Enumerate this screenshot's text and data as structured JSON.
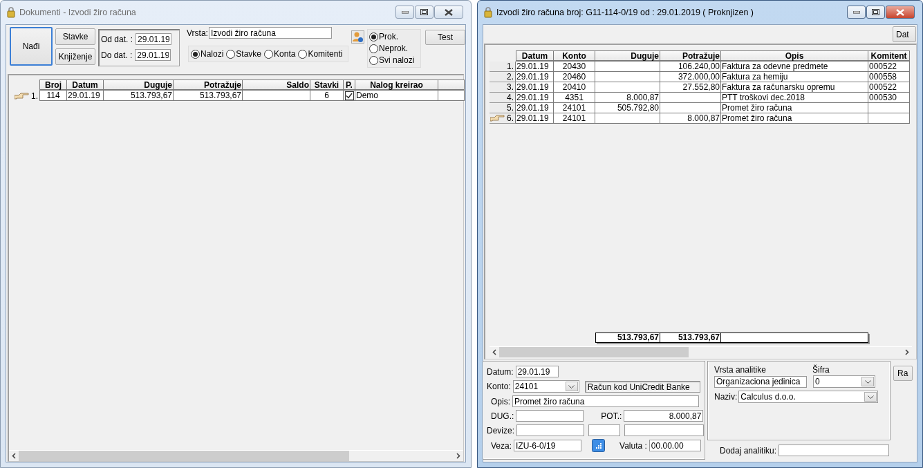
{
  "left_window": {
    "title": "Dokumenti - Izvodi žiro računa",
    "active": false,
    "buttons": {
      "find": "Nađi",
      "items": "Stavke",
      "posting": "Knjiženje",
      "test": "Test"
    },
    "date_range": [
      {
        "label": "Od dat. :",
        "value": "29.01.19"
      },
      {
        "label": "Do dat. :",
        "value": "29.01.19"
      }
    ],
    "type_field": {
      "label": "Vrsta:",
      "value": "Izvodi žiro računa"
    },
    "status_options": [
      {
        "label": "Prok.",
        "selected": true
      },
      {
        "label": "Neprok.",
        "selected": false
      },
      {
        "label": "Svi nalozi",
        "selected": false
      }
    ],
    "view_options": [
      {
        "label": "Nalozi",
        "selected": true
      },
      {
        "label": "Stavke",
        "selected": false
      },
      {
        "label": "Konta",
        "selected": false
      },
      {
        "label": "Komitenti",
        "selected": false
      }
    ],
    "table": {
      "columns": [
        "Broj",
        "Datum",
        "Duguje",
        "Potražuje",
        "Saldo",
        "Stavki",
        "P.",
        "Nalog kreirao"
      ],
      "rows": [
        {
          "number": "1.",
          "current": true,
          "broj": "114",
          "datum": "29.01.19",
          "duguje": "513.793,67",
          "potrazuje": "513.793,67",
          "stavki": "6",
          "posted": true,
          "kreirao": "Demo"
        }
      ]
    }
  },
  "right_window": {
    "title": "Izvodi žiro računa broj: G11-114-0/19  od : 29.01.2019 ( Proknjizen )",
    "active": true,
    "top_button": "Dat",
    "table": {
      "columns": [
        "Datum",
        "Konto",
        "Duguje",
        "Potražuje",
        "Opis",
        "Komitent"
      ],
      "rows": [
        {
          "number": "1.",
          "current": false,
          "datum": "29.01.19",
          "konto": "20430",
          "potrazuje": "106.240,00",
          "opis": "Faktura za odevne predmete",
          "komitent": "000522"
        },
        {
          "number": "2.",
          "current": false,
          "datum": "29.01.19",
          "konto": "20460",
          "potrazuje": "372.000,00",
          "opis": "Faktura za hemiju",
          "komitent": "000558"
        },
        {
          "number": "3.",
          "current": false,
          "datum": "29.01.19",
          "konto": "20410",
          "potrazuje": "27.552,80",
          "opis": "Faktura za računarsku opremu",
          "komitent": "000522"
        },
        {
          "number": "4.",
          "current": false,
          "datum": "29.01.19",
          "konto": "4351",
          "duguje": "8.000,87",
          "opis": "PTT troškovi dec.2018",
          "komitent": "000530"
        },
        {
          "number": "5.",
          "current": false,
          "datum": "29.01.19",
          "konto": "24101",
          "duguje": "505.792,80",
          "opis": "Promet žiro računa"
        },
        {
          "number": "6.",
          "current": true,
          "datum": "29.01.19",
          "konto": "24101",
          "potrazuje": "8.000,87",
          "opis": "Promet žiro računa"
        }
      ],
      "totals": {
        "duguje": "513.793,67",
        "potrazuje": "513.793,67"
      }
    },
    "form": {
      "datum": {
        "label": "Datum:",
        "value": "29.01.19"
      },
      "konto": {
        "label": "Konto:",
        "value": "24101",
        "name": "Račun kod UniCredit Banke"
      },
      "opis": {
        "label": "Opis:",
        "value": "Promet žiro računa"
      },
      "dug": {
        "label": "DUG.:"
      },
      "pot": {
        "label": "POT.:",
        "value": "8.000,87"
      },
      "devize": {
        "label": "Devize:"
      },
      "veza": {
        "label": "Veza:",
        "value": "IZU-6-0/19"
      },
      "valuta": {
        "label": "Valuta :",
        "value": "00.00.00"
      }
    },
    "analytics": {
      "type_label": "Vrsta analitike",
      "code_label": "Šifra",
      "type_value": "Organizaciona jedinica",
      "code_value": "0",
      "name_label": "Naziv:",
      "name_value": "Calculus d.o.o.",
      "add_label": "Dodaj analitiku:"
    },
    "side_button": "Ra"
  }
}
